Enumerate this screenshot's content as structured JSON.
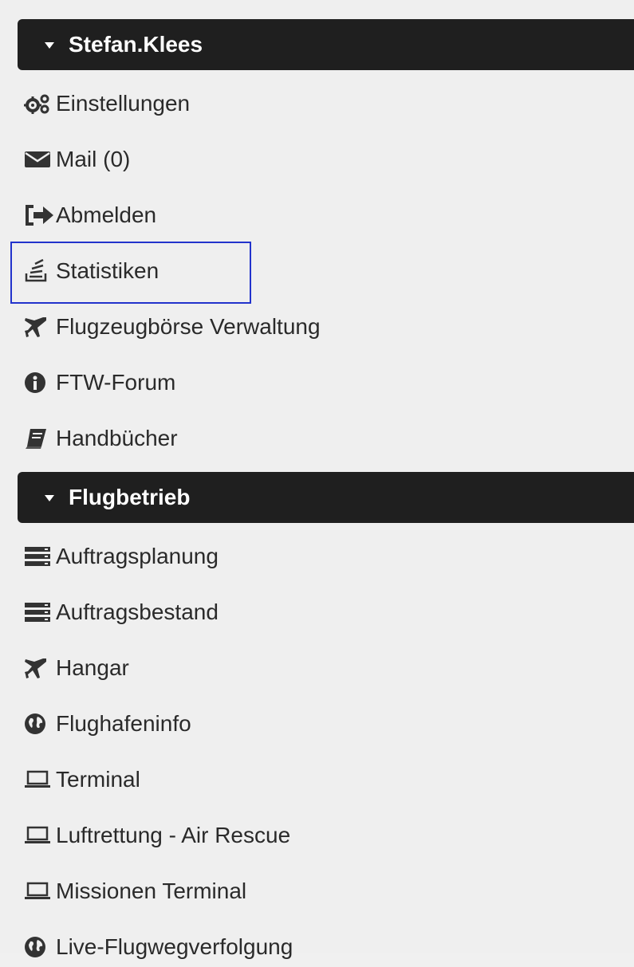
{
  "sections": [
    {
      "title": "Stefan.Klees",
      "items": [
        {
          "label": "Einstellungen",
          "icon": "cogs-icon"
        },
        {
          "label": "Mail (0)",
          "icon": "envelope-icon"
        },
        {
          "label": "Abmelden",
          "icon": "sign-out-icon"
        },
        {
          "label": "Statistiken",
          "icon": "stack-icon"
        },
        {
          "label": "Flugzeugbörse Verwaltung",
          "icon": "plane-icon"
        },
        {
          "label": "FTW-Forum",
          "icon": "info-icon"
        },
        {
          "label": "Handbücher",
          "icon": "book-icon"
        }
      ]
    },
    {
      "title": "Flugbetrieb",
      "items": [
        {
          "label": "Auftragsplanung",
          "icon": "server-icon"
        },
        {
          "label": "Auftragsbestand",
          "icon": "server-icon"
        },
        {
          "label": "Hangar",
          "icon": "plane-icon"
        },
        {
          "label": "Flughafeninfo",
          "icon": "globe-icon"
        },
        {
          "label": "Terminal",
          "icon": "laptop-icon"
        },
        {
          "label": "Luftrettung - Air Rescue",
          "icon": "laptop-icon"
        },
        {
          "label": "Missionen Terminal",
          "icon": "laptop-icon"
        },
        {
          "label": "Live-Flugwegverfolgung",
          "icon": "globe-icon"
        }
      ]
    }
  ],
  "colors": {
    "header_bg": "#1f1f1f",
    "highlight": "#2233cc",
    "page_bg": "#efefef"
  }
}
